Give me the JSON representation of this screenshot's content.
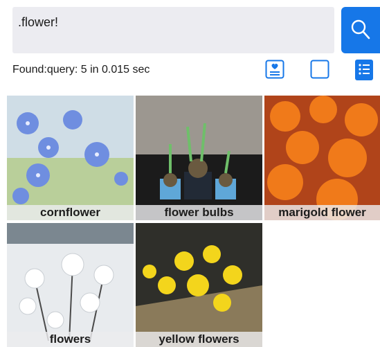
{
  "search": {
    "query": ".flower!"
  },
  "status": {
    "text": "Found:query: 5 in 0.015 sec"
  },
  "toolbar": {
    "icons": [
      "card-view-icon",
      "square-view-icon",
      "list-view-icon"
    ],
    "accent": "#1677e8"
  },
  "results": [
    {
      "label": "cornflower"
    },
    {
      "label": "flower bulbs"
    },
    {
      "label": "marigold flower"
    },
    {
      "label": "flowers"
    },
    {
      "label": "yellow flowers"
    }
  ]
}
